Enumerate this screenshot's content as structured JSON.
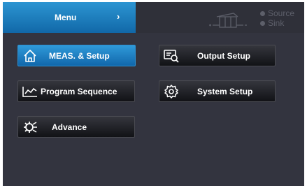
{
  "header": {
    "menu_label": "Menu",
    "menu_chevron": "›",
    "status_legend": [
      {
        "label": "Source",
        "icon": "status-dot"
      },
      {
        "label": "Sink",
        "icon": "status-dot"
      }
    ]
  },
  "buttons": [
    {
      "id": "meas",
      "label": "MEAS. & Setup",
      "icon": "home-icon",
      "state": "selected"
    },
    {
      "id": "program",
      "label": "Program Sequence",
      "icon": "program-chart-icon",
      "state": "normal"
    },
    {
      "id": "advance",
      "label": "Advance",
      "icon": "advance-gear-icon",
      "state": "normal"
    },
    {
      "id": "output",
      "label": "Output Setup",
      "icon": "output-setup-icon",
      "state": "normal"
    },
    {
      "id": "system",
      "label": "System Setup",
      "icon": "system-gear-icon",
      "state": "normal"
    }
  ],
  "colors": {
    "accent": "#1a80c4",
    "background": "#33343f",
    "button_dark": "#1f2025",
    "text": "#ffffff",
    "legend_text": "#5d5f6a"
  }
}
